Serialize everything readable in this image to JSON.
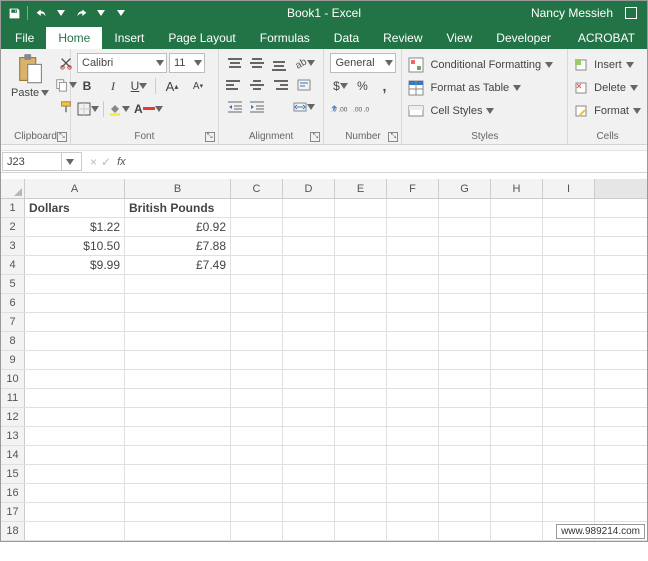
{
  "title": "Book1 - Excel",
  "user": "Nancy Messieh",
  "qat": {
    "save": "save-icon",
    "undo": "undo-icon",
    "redo": "redo-icon"
  },
  "tabs": {
    "file": "File",
    "home": "Home",
    "insert": "Insert",
    "pagelayout": "Page Layout",
    "formulas": "Formulas",
    "data": "Data",
    "review": "Review",
    "view": "View",
    "developer": "Developer",
    "acrobat": "ACROBAT"
  },
  "ribbon": {
    "clipboard": {
      "label": "Clipboard",
      "paste": "Paste",
      "cut": "cut-icon",
      "copy": "copy-icon",
      "painter": "format-painter-icon"
    },
    "font": {
      "label": "Font",
      "family": "Calibri",
      "size": "11",
      "bold": "B",
      "italic": "I",
      "underline": "U",
      "grow": "A",
      "shrink": "A",
      "border": "border-icon",
      "fill": "fill-color-icon",
      "color": "font-color-icon"
    },
    "alignment": {
      "label": "Alignment",
      "wrap": "wrap-text-icon",
      "merge": "merge-center-icon",
      "indent_dec": "decrease-indent-icon",
      "indent_inc": "increase-indent-icon",
      "orient": "orientation-icon"
    },
    "number": {
      "label": "Number",
      "format": "General",
      "currency": "currency-icon",
      "percent": "%",
      "comma": ",",
      "inc_dec": "increase-decimal-icon",
      "dec_dec": "decrease-decimal-icon"
    },
    "styles": {
      "label": "Styles",
      "cond": "Conditional Formatting",
      "table": "Format as Table",
      "cell": "Cell Styles"
    },
    "cells": {
      "label": "Cells",
      "insert": "Insert",
      "delete": "Delete",
      "format": "Format"
    }
  },
  "fbar": {
    "name": "J23",
    "cancel": "×",
    "enter": "✓",
    "fx": "fx",
    "formula": ""
  },
  "columns": [
    "A",
    "B",
    "C",
    "D",
    "E",
    "F",
    "G",
    "H",
    "I"
  ],
  "rows": [
    "1",
    "2",
    "3",
    "4",
    "5",
    "6",
    "7",
    "8",
    "9",
    "10",
    "11",
    "12",
    "13",
    "14",
    "15",
    "16",
    "17",
    "18"
  ],
  "cells": {
    "A1": "Dollars",
    "B1": "British Pounds",
    "A2": "$1.22",
    "B2": "£0.92",
    "A3": "$10.50",
    "B3": "£7.88",
    "A4": "$9.99",
    "B4": "£7.49"
  },
  "chart_data": {
    "type": "table",
    "columns": [
      "Dollars",
      "British Pounds"
    ],
    "rows": [
      {
        "Dollars": 1.22,
        "British Pounds": 0.92
      },
      {
        "Dollars": 10.5,
        "British Pounds": 7.88
      },
      {
        "Dollars": 9.99,
        "British Pounds": 7.49
      }
    ]
  },
  "watermark": "www.989214.com"
}
